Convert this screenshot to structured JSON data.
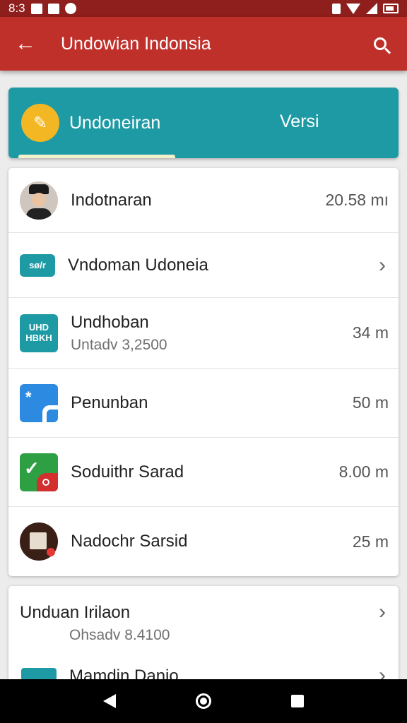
{
  "status_bar": {
    "time": "8:3"
  },
  "app_bar": {
    "title": "Undowian Indonsia"
  },
  "promo": {
    "left_label": "Undoneiran",
    "right_label": "Versi"
  },
  "list": [
    {
      "title": "Indotnaran",
      "sub": "",
      "value": "20.58 mı",
      "icon": "person-avatar-icon"
    },
    {
      "title": "Vndoman Udoneia",
      "sub": "",
      "value": "",
      "icon": "sound-icon",
      "icon_text": "sø/r"
    },
    {
      "title": "Undhoban",
      "sub": "Untadv 3,2500",
      "value": "34 m",
      "icon": "qr-code-icon",
      "icon_text_1": "UHD",
      "icon_text_2": "HBKH"
    },
    {
      "title": "Penunban",
      "sub": "",
      "value": "50 m",
      "icon": "blue-app-icon"
    },
    {
      "title": "Soduithr Sarad",
      "sub": "",
      "value": "8.00 m",
      "icon": "green-app-icon"
    },
    {
      "title": "Nadochr Sarsid",
      "sub": "",
      "value": "25 m",
      "icon": "document-icon"
    }
  ],
  "card2": {
    "title": "Unduan Irilaon",
    "sub": "Ohsadv 8.4100",
    "row2_title": "Mamdin Danio"
  },
  "colors": {
    "app_bar": "#c0302b",
    "status_bar": "#8e1f1d",
    "teal": "#1e9aa4",
    "amber": "#f2b722"
  }
}
